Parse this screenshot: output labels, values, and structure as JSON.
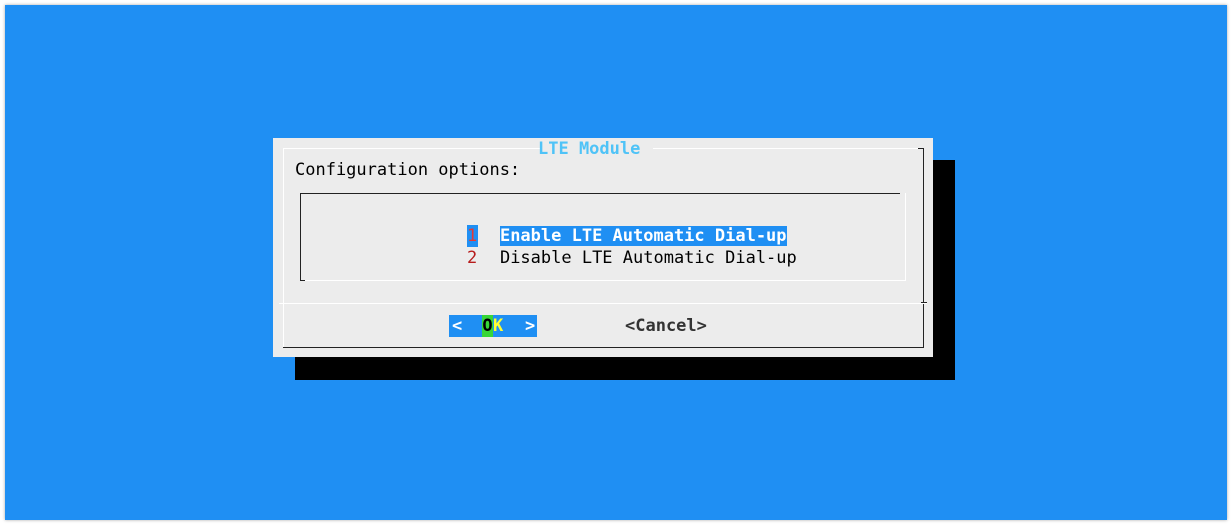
{
  "dialog": {
    "title": "LTE Module",
    "prompt": "Configuration options:"
  },
  "menu": {
    "items": [
      {
        "tag": "1",
        "label": "Enable LTE Automatic Dial-up",
        "selected": true
      },
      {
        "tag": "2",
        "label": "Disable LTE Automatic Dial-up",
        "selected": false
      }
    ]
  },
  "buttons": {
    "ok": {
      "left": "<",
      "hotkey": "O",
      "rest": "K",
      "right": ">"
    },
    "cancel": "<Cancel>"
  },
  "colors": {
    "terminal_bg": "#1f8ff3",
    "dialog_bg": "#ececec",
    "title": "#4fc3f7",
    "tag": "#b71c1c",
    "hotkey_bg": "#37d637",
    "hotkey_rest": "#ffff33"
  }
}
